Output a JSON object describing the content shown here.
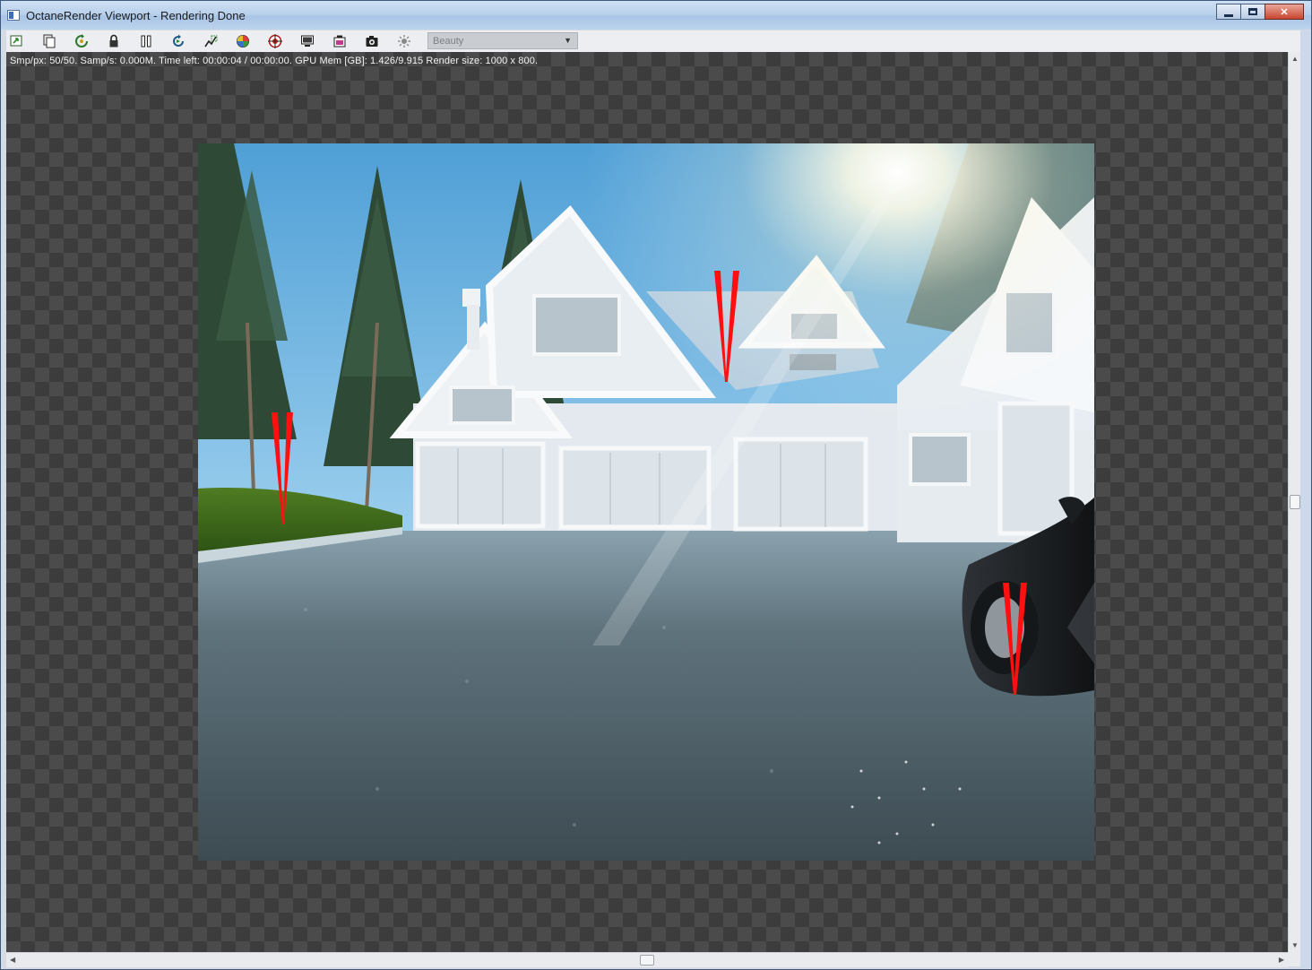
{
  "window": {
    "title": "OctaneRender Viewport - Rendering Done",
    "buttons": {
      "minimize": "minimize-icon",
      "maximize": "maximize-icon",
      "close": "close-icon"
    }
  },
  "toolbar": {
    "icons": [
      "send-scene-icon",
      "copy-image-icon",
      "refresh-icon",
      "lock-icon",
      "pause-icon",
      "restart-icon",
      "region-render-icon",
      "color-picker-icon",
      "focus-picker-icon",
      "display-icon",
      "clay-mode-icon",
      "snapshot-icon",
      "sun-settings-icon"
    ],
    "pass_select": {
      "value": "Beauty"
    }
  },
  "status": {
    "text": "Smp/px: 50/50.    Samp/s: 0.000M.    Time left: 00:00:04 / 00:00:00.    GPU Mem [GB]: 1.426/9.915    Render size: 1000 x 800."
  },
  "render": {
    "width": 1000,
    "height": 800,
    "scene": "render-image",
    "annotation_marks": [
      "annotation-mark-lawn",
      "annotation-mark-roof",
      "annotation-mark-car"
    ],
    "annotation_color": "#ff1010"
  },
  "colors": {
    "title_bar": "#b9d1ec",
    "viewport_checker_dark": "#3c3c3c",
    "viewport_checker_light": "#4b4b4b",
    "sky_top": "#5aa6d8",
    "sky_bottom": "#d8eef6",
    "house": "#dfe5ea",
    "asphalt": "#4c5a62",
    "grass": "#3c6a1c"
  }
}
